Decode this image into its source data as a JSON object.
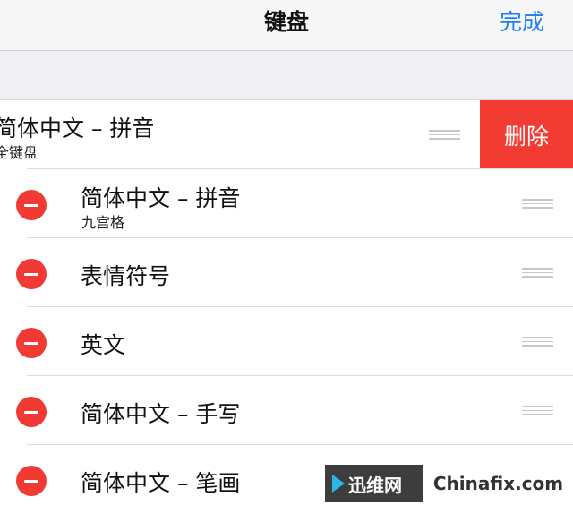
{
  "nav": {
    "title": "键盘",
    "done_label": "完成"
  },
  "keyboards": [
    {
      "label": "简体中文 – 拼音",
      "sublabel": "全键盘",
      "state": "swiped-delete"
    },
    {
      "label": "简体中文 – 拼音",
      "sublabel": "九宫格"
    },
    {
      "label": "表情符号"
    },
    {
      "label": "英文"
    },
    {
      "label": "简体中文 – 手写"
    },
    {
      "label": "简体中文 – 笔画"
    }
  ],
  "delete_label": "删除",
  "watermark": {
    "cn_text": "迅维网",
    "domain_text": "Chinafix.com"
  },
  "colors": {
    "accent": "#1a7ff5",
    "delete": "#f23b33",
    "minus": "#f03a33"
  },
  "icons": {
    "remove": "minus-circle-icon",
    "reorder": "reorder-handle-icon"
  }
}
